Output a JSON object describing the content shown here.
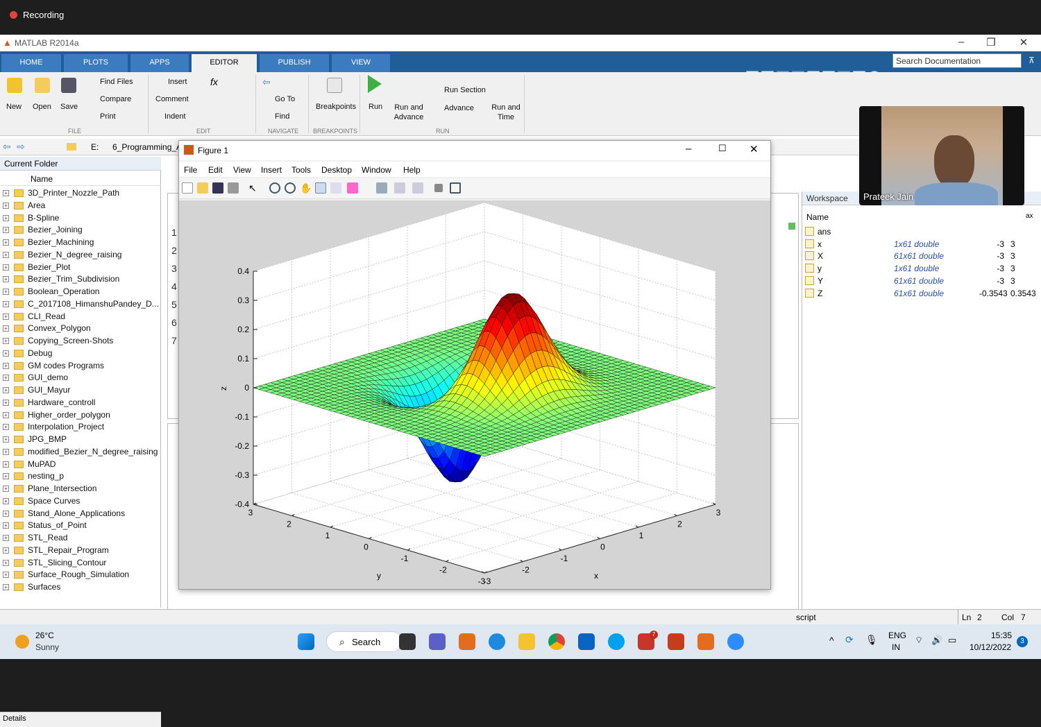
{
  "recording": {
    "label": "Recording"
  },
  "app": {
    "title": "MATLAB R2014a"
  },
  "tabs": [
    "HOME",
    "PLOTS",
    "APPS",
    "EDITOR",
    "PUBLISH",
    "VIEW"
  ],
  "search_placeholder": "Search Documentation",
  "ribbon": {
    "file": {
      "new": "New",
      "open": "Open",
      "save": "Save",
      "find_files": "Find Files",
      "compare": "Compare",
      "print": "Print",
      "group": "FILE"
    },
    "edit": {
      "insert": "Insert",
      "comment": "Comment",
      "indent": "Indent",
      "group": "EDIT"
    },
    "navigate": {
      "goto": "Go To",
      "find": "Find",
      "group": "NAVIGATE"
    },
    "breakpoints": {
      "label": "Breakpoints",
      "group": "BREAKPOINTS"
    },
    "run": {
      "run": "Run",
      "run_advance": "Run and Advance",
      "run_section": "Run Section",
      "advance": "Advance",
      "run_time": "Run and Time",
      "group": "RUN"
    }
  },
  "address": {
    "drive": "E:",
    "folder": "6_Programming_A"
  },
  "current_folder": {
    "title": "Current Folder",
    "col_name": "Name",
    "items": [
      "3D_Printer_Nozzle_Path",
      "Area",
      "B-Spline",
      "Bezier_Joining",
      "Bezier_Machining",
      "Bezier_N_degree_raising",
      "Bezier_Plot",
      "Bezier_Trim_Subdivision",
      "Boolean_Operation",
      "C_2017108_HimanshuPandey_D...",
      "CLI_Read",
      "Convex_Polygon",
      "Copying_Screen-Shots",
      "Debug",
      "GM codes Programs",
      "GUI_demo",
      "GUI_Mayur",
      "Hardware_controll",
      "Higher_order_polygon",
      "Interpolation_Project",
      "JPG_BMP",
      "modified_Bezier_N_degree_raising",
      "MuPAD",
      "nesting_p",
      "Plane_Intersection",
      "Space Curves",
      "Stand_Alone_Applications",
      "Status_of_Point",
      "STL_Read",
      "STL_Repair_Program",
      "STL_Slicing_Contour",
      "Surface_Rough_Simulation",
      "Surfaces"
    ],
    "details": "Details"
  },
  "editor_lines": [
    "1",
    "2",
    "3",
    "4",
    "5",
    "6",
    "7"
  ],
  "workspace": {
    "title": "Workspace",
    "col_name": "Name",
    "col_max": "ax",
    "vars": [
      {
        "name": "ans",
        "value": "",
        "min": "",
        "max": ""
      },
      {
        "name": "x",
        "value": "1x61 double",
        "min": "-3",
        "max": "3"
      },
      {
        "name": "X",
        "value": "61x61 double",
        "min": "-3",
        "max": "3"
      },
      {
        "name": "y",
        "value": "1x61 double",
        "min": "-3",
        "max": "3"
      },
      {
        "name": "Y",
        "value": "61x61 double",
        "min": "-3",
        "max": "3"
      },
      {
        "name": "Z",
        "value": "61x61 double",
        "min": "-0.3543",
        "max": "0.3543"
      }
    ]
  },
  "figure": {
    "title": "Figure 1",
    "menu": [
      "File",
      "Edit",
      "View",
      "Insert",
      "Tools",
      "Desktop",
      "Window",
      "Help"
    ]
  },
  "chart_data": {
    "type": "surface",
    "zlabel": "z",
    "xlabel": "x",
    "ylabel": "y",
    "zticks": [
      "0.4",
      "0.3",
      "0.2",
      "0.1",
      "0",
      "-0.1",
      "-0.2",
      "-0.3",
      "-0.4"
    ],
    "yticks": [
      "3",
      "2",
      "1",
      "0",
      "-1",
      "-2",
      "-3"
    ],
    "xticks": [
      "-3",
      "-2",
      "-1",
      "0",
      "1",
      "2",
      "3"
    ],
    "zlim": [
      -0.4,
      0.4
    ],
    "xlim": [
      -3,
      3
    ],
    "ylim": [
      -3,
      3
    ],
    "peak_z": 0.3543,
    "trough_z": -0.3543,
    "colormap": "jet"
  },
  "command": {
    "prompt": ">>",
    "fx": "fx"
  },
  "status": {
    "script": "script",
    "ln_label": "Ln",
    "ln": "2",
    "col_label": "Col",
    "col": "7"
  },
  "webcam": {
    "name": "Prateek Jain"
  },
  "taskbar": {
    "weather_temp": "26°C",
    "weather_desc": "Sunny",
    "search": "Search",
    "lang1": "ENG",
    "lang2": "IN",
    "time": "15:35",
    "date": "10/12/2022",
    "notif": "3",
    "badge": "7"
  }
}
